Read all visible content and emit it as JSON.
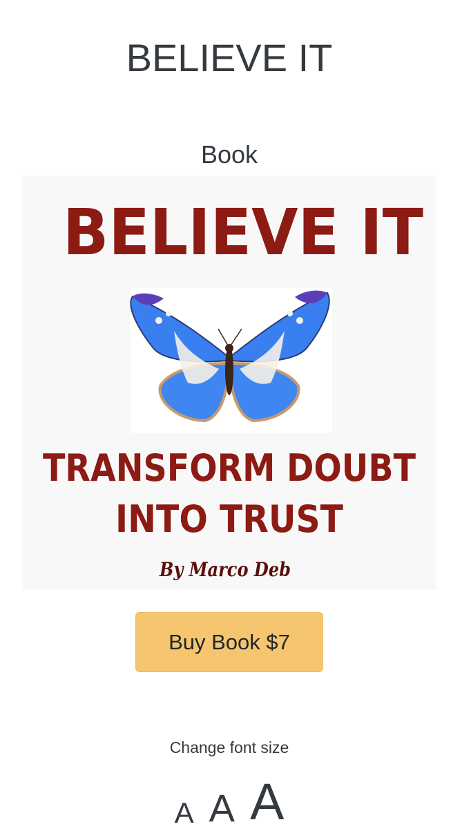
{
  "page": {
    "title": "BELIEVE IT",
    "section_heading": "Book"
  },
  "cover": {
    "title": "BELIEVE IT",
    "subtitle_line1": "TRANSFORM DOUBT",
    "subtitle_line2": "INTO TRUST",
    "author": "By Marco Deb",
    "title_color": "#8c1b14",
    "author_color": "#5a0f0b",
    "background": "#f8f8f8",
    "image": "blue-butterfly"
  },
  "purchase": {
    "buy_label": "Buy Book $7",
    "button_color": "#f5c66f"
  },
  "font_controls": {
    "label": "Change font size",
    "small": "A",
    "medium": "A",
    "large": "A"
  }
}
